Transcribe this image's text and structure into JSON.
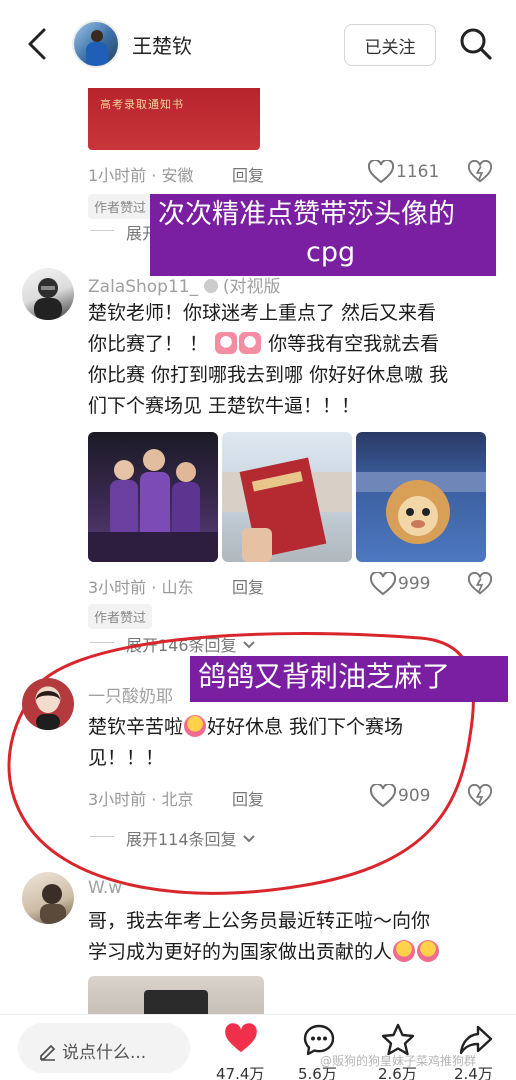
{
  "header": {
    "username": "王楚钦",
    "follow_label": "已关注"
  },
  "top_image": {
    "text": "高考录取通知书"
  },
  "comment0": {
    "time_loc": "1小时前 · 安徽",
    "reply": "回复",
    "likes": "1161",
    "author_tag": "作者赞过",
    "expand": "展开"
  },
  "overlay1": {
    "line1": "次次精准点赞带莎头像的",
    "line2": "cpg"
  },
  "comment1": {
    "username": "ZalaShop11_",
    "username_suffix": "(对视版",
    "line1": "楚钦老师！你球迷考上重点了 然后又来看",
    "line2a": "你比赛了！ ！",
    "line2b": "你等我有空我就去看",
    "line3": "你比赛 你打到哪我去到哪 你好好休息嗷 我",
    "line4": "们下个赛场见 王楚钦牛逼！！！",
    "time_loc": "3小时前 · 山东",
    "reply": "回复",
    "likes": "999",
    "author_tag": "作者赞过",
    "expand": "展开146条回复"
  },
  "overlay2": {
    "text": "鸽鸽又背刺油芝麻了"
  },
  "comment2": {
    "username": "一只酸奶耶",
    "line1a": "楚钦辛苦啦",
    "line1b": "好好休息 我们下个赛场",
    "line2": "见！！！",
    "time_loc": "3小时前 · 北京",
    "reply": "回复",
    "likes": "909",
    "expand": "展开114条回复"
  },
  "comment3": {
    "username": "W.w",
    "line1": "哥，我去年考上公务员最近转正啦～向你",
    "line2": "学习成为更好的为国家做出贡献的人"
  },
  "bottom_bar": {
    "placeholder": "说点什么...",
    "likes": "47.4万",
    "comments": "5.6万",
    "stars": "2.6万",
    "shares": "2.4万"
  },
  "watermark": "@贩狗的狗皇妹子菜鸡推狗群",
  "colors": {
    "overlay_purple": "#7b1fa2",
    "like_red": "#f0304a",
    "circle_red": "#d9262c"
  }
}
